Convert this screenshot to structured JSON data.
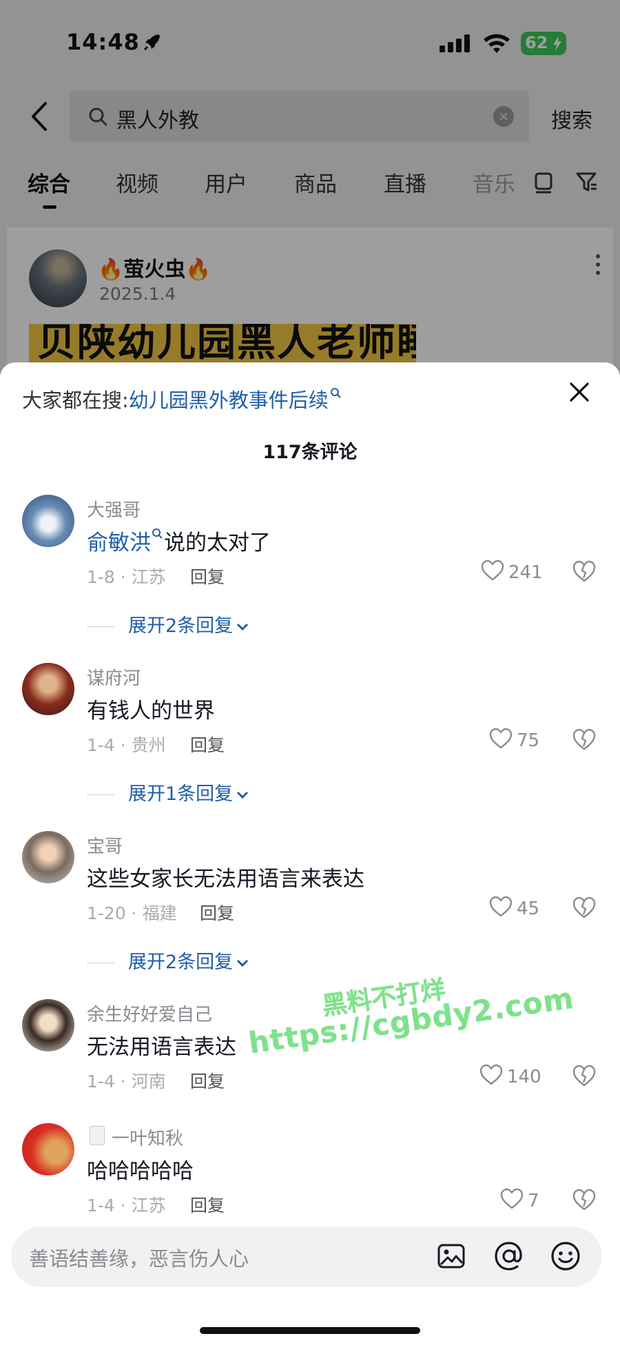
{
  "status_bar": {
    "time": "14:48",
    "battery": "62"
  },
  "search": {
    "query": "黑人外教",
    "button": "搜索"
  },
  "tabs": [
    "综合",
    "视频",
    "用户",
    "商品",
    "直播",
    "音乐"
  ],
  "post": {
    "author": "萤火虫",
    "date": "2025.1.4",
    "thumb_text": "贝陕幼儿园黑人老师睡"
  },
  "sheet": {
    "trending_prefix": "大家都在搜:",
    "trending_link": "幼儿园黑外教事件后续",
    "count": "117条评论"
  },
  "comments": [
    {
      "user": "大强哥",
      "mention": "俞敏洪",
      "text": "说的太对了",
      "meta": "1-8 · 江苏",
      "reply": "回复",
      "likes": "241",
      "expand": "展开2条回复"
    },
    {
      "user": "谋府河",
      "text": "有钱人的世界",
      "meta": "1-4 · 贵州",
      "reply": "回复",
      "likes": "75",
      "expand": "展开1条回复"
    },
    {
      "user": "宝哥",
      "text": "这些女家长无法用语言来表达",
      "meta": "1-20 · 福建",
      "reply": "回复",
      "likes": "45",
      "expand": "展开2条回复"
    },
    {
      "user": "余生好好爱自己",
      "text": "无法用语言表达",
      "meta": "1-4 · 河南",
      "reply": "回复",
      "likes": "140"
    },
    {
      "user": "一叶知秋",
      "text": "哈哈哈哈哈",
      "meta": "1-4 · 江苏",
      "reply": "回复",
      "likes": "7"
    }
  ],
  "watermark": {
    "line1": "黑料不打烊",
    "line2": "https://cgbdy2.com"
  },
  "input": {
    "placeholder": "善语结善缘，恶言伤人心"
  },
  "colors": {
    "link": "#1f5fa8",
    "battery": "#3cc85a",
    "watermark": "#7de28a"
  }
}
